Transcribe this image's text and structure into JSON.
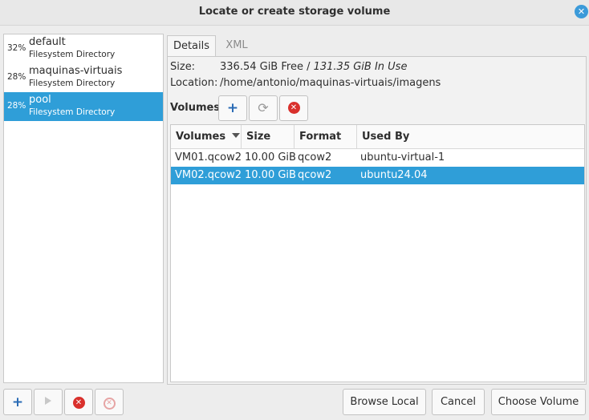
{
  "window": {
    "title": "Locate or create storage volume"
  },
  "pools": [
    {
      "pct": "32%",
      "name": "default",
      "type": "Filesystem Directory"
    },
    {
      "pct": "28%",
      "name": "maquinas-virtuais",
      "type": "Filesystem Directory"
    },
    {
      "pct": "28%",
      "name": "pool",
      "type": "Filesystem Directory",
      "selected": true
    }
  ],
  "tabs": {
    "details": "Details",
    "xml": "XML",
    "active": "Details"
  },
  "details": {
    "size_label": "Size:",
    "size_free": "336.54 GiB Free",
    "size_sep": " / ",
    "size_in_use": "131.35 GiB In Use",
    "location_label": "Location:",
    "location_value": "/home/antonio/maquinas-virtuais/imagens",
    "volumes_label": "Volumes"
  },
  "volume_toolbar": {
    "add_icon": "add-icon",
    "refresh_icon": "refresh-icon",
    "delete_icon": "delete-icon"
  },
  "volume_table": {
    "columns": [
      "Volumes",
      "Size",
      "Format",
      "Used By"
    ],
    "sort_column": "Volumes",
    "rows": [
      [
        "VM01.qcow2",
        "10.00 GiB",
        "qcow2",
        "ubuntu-virtual-1"
      ],
      [
        "VM02.qcow2",
        "10.00 GiB",
        "qcow2",
        "ubuntu24.04"
      ]
    ],
    "selected_row": 1
  },
  "pool_toolbar": {
    "add_icon": "add-icon",
    "start_icon": "play-icon",
    "stop_icon": "stop-icon",
    "delete_icon": "delete-icon"
  },
  "buttons": {
    "browse_local": "Browse Local",
    "cancel": "Cancel",
    "choose_volume": "Choose Volume"
  },
  "colors": {
    "selection": "#2f9ed8",
    "close_button": "#3b9ad9",
    "danger": "#d9302c"
  }
}
